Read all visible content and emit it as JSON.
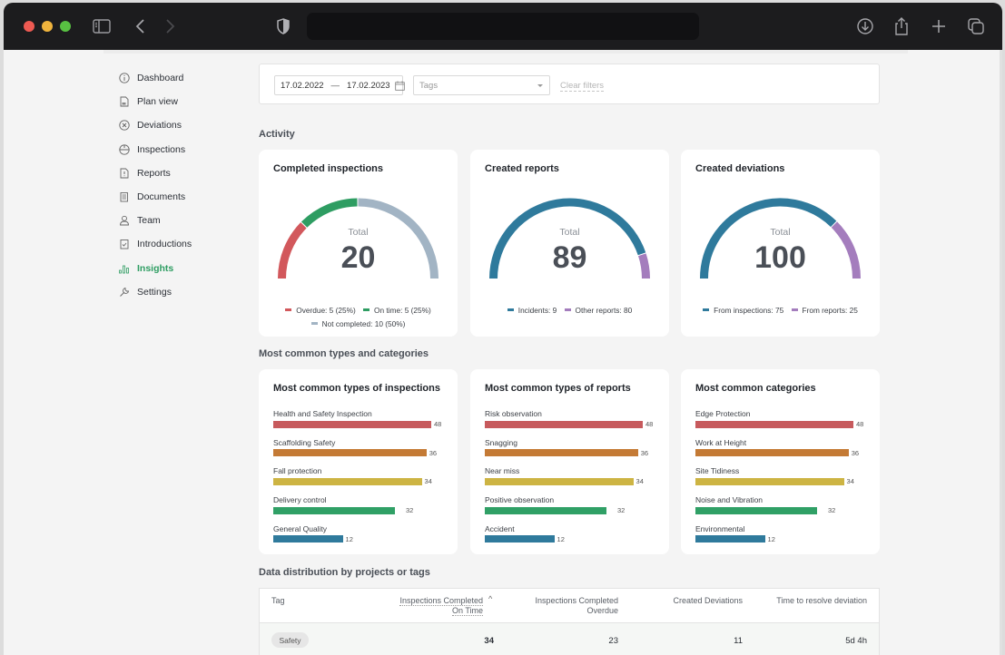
{
  "browser": {
    "icons": [
      "sidebar-icon",
      "back-icon",
      "forward-icon",
      "shield-icon",
      "download-icon",
      "share-icon",
      "new-tab-icon",
      "tabs-icon"
    ]
  },
  "sidebar": {
    "items": [
      {
        "label": "Dashboard",
        "icon": "info-icon",
        "active": false
      },
      {
        "label": "Plan view",
        "icon": "plan-icon",
        "active": false
      },
      {
        "label": "Deviations",
        "icon": "x-circle-icon",
        "active": false
      },
      {
        "label": "Inspections",
        "icon": "helmet-icon",
        "active": false
      },
      {
        "label": "Reports",
        "icon": "report-icon",
        "active": false
      },
      {
        "label": "Documents",
        "icon": "document-icon",
        "active": false
      },
      {
        "label": "Team",
        "icon": "user-icon",
        "active": false
      },
      {
        "label": "Introductions",
        "icon": "clipboard-check-icon",
        "active": false
      },
      {
        "label": "Insights",
        "icon": "bar-chart-icon",
        "active": true
      },
      {
        "label": "Settings",
        "icon": "wrench-icon",
        "active": false
      }
    ]
  },
  "filters": {
    "date_from": "17.02.2022",
    "date_sep": "—",
    "date_to": "17.02.2023",
    "tags_placeholder": "Tags",
    "clear_label": "Clear filters"
  },
  "sections": {
    "activity": "Activity",
    "common": "Most common types and categories",
    "distribution": "Data distribution by projects or tags"
  },
  "colors": {
    "red": "#d2585c",
    "green": "#2e9d62",
    "grey": "#a2b4c4",
    "blue": "#2f7a9c",
    "purple": "#a47dbd",
    "orange": "#c47a35",
    "yellow": "#cdb443",
    "bar_red": "#c75a5d",
    "bar_green": "#30a066",
    "bar_blue": "#2f7a9c"
  },
  "chart_data": [
    {
      "type": "pie",
      "variant": "semi-donut",
      "title": "Completed inspections",
      "center_label": "Total",
      "total": "20",
      "slices": [
        {
          "name": "Overdue",
          "value": 5,
          "legend": "Overdue: 5 (25%)",
          "color": "#d2585c"
        },
        {
          "name": "On time",
          "value": 5,
          "legend": "On time: 5 (25%)",
          "color": "#2e9d62"
        },
        {
          "name": "Not completed",
          "value": 10,
          "legend": "Not completed: 10 (50%)",
          "color": "#a2b4c4"
        }
      ]
    },
    {
      "type": "pie",
      "variant": "semi-donut",
      "title": "Created reports",
      "center_label": "Total",
      "total": "89",
      "slices": [
        {
          "name": "Other reports",
          "value": 80,
          "legend": "Other reports: 80",
          "color": "#2f7a9c"
        },
        {
          "name": "Incidents",
          "value": 9,
          "legend": "Incidents: 9",
          "color": "#a47dbd"
        }
      ],
      "legend_order": [
        "Incidents: 9",
        "Other reports: 80"
      ],
      "legend_colors": [
        "#2f7a9c",
        "#a47dbd"
      ]
    },
    {
      "type": "pie",
      "variant": "semi-donut",
      "title": "Created deviations",
      "center_label": "Total",
      "total": "100",
      "slices": [
        {
          "name": "From inspections",
          "value": 75,
          "legend": "From inspections: 75",
          "color": "#2f7a9c"
        },
        {
          "name": "From reports",
          "value": 25,
          "legend": "From reports: 25",
          "color": "#a47dbd"
        }
      ]
    },
    {
      "type": "bar",
      "orientation": "horizontal",
      "title": "Most common types of inspections",
      "categories": [
        "Health and Safety Inspection",
        "Scaffolding Safety",
        "Fall protection",
        "Delivery control",
        "General Quality"
      ],
      "values": [
        48,
        36,
        34,
        32,
        12
      ],
      "relative_lengths": [
        1.0,
        0.97,
        0.94,
        0.77,
        0.44
      ]
    },
    {
      "type": "bar",
      "orientation": "horizontal",
      "title": "Most common types of reports",
      "categories": [
        "Risk observation",
        "Snagging",
        "Near miss",
        "Positive observation",
        "Accident"
      ],
      "values": [
        48,
        36,
        34,
        32,
        12
      ],
      "relative_lengths": [
        1.0,
        0.97,
        0.94,
        0.77,
        0.44
      ]
    },
    {
      "type": "bar",
      "orientation": "horizontal",
      "title": "Most common categories",
      "categories": [
        "Edge Protection",
        "Work at Height",
        "Site Tidiness",
        "Noise and Vibration",
        "Environmental"
      ],
      "values": [
        48,
        36,
        34,
        32,
        12
      ],
      "relative_lengths": [
        1.0,
        0.97,
        0.94,
        0.77,
        0.44
      ]
    }
  ],
  "table": {
    "columns": [
      {
        "label": "Tag"
      },
      {
        "label_line1": "Inspections Completed",
        "label_line2": "On Time",
        "sorted": "asc"
      },
      {
        "label_line1": "Inspections Completed",
        "label_line2": "Overdue"
      },
      {
        "label": "Created Deviations"
      },
      {
        "label": "Time to resolve deviation"
      }
    ],
    "rows": [
      {
        "tag": "Safety",
        "on_time": "34",
        "overdue": "23",
        "deviations": "11",
        "resolve_time": "5d 4h"
      }
    ]
  }
}
